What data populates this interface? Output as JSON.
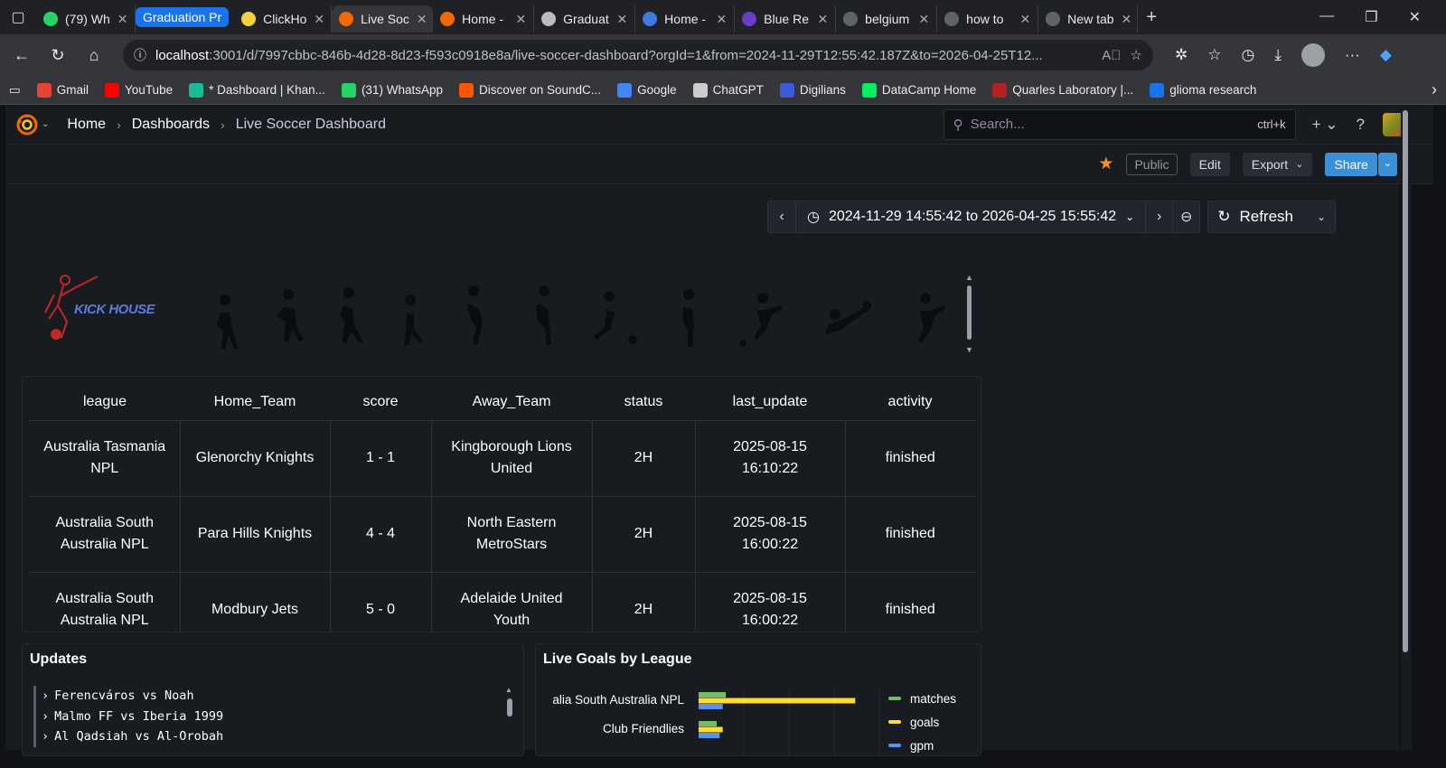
{
  "browser": {
    "tabs": [
      {
        "label": "(79) Wh",
        "icon": "whatsapp-icon",
        "color": "#25d366"
      },
      {
        "label": "Graduation Pr",
        "icon": "tab-group",
        "color": "#1a73e8"
      },
      {
        "label": "ClickHo",
        "icon": "clickhouse-icon",
        "color": "#f4d03f"
      },
      {
        "label": "Live Soc",
        "icon": "grafana-icon",
        "color": "#f46800"
      },
      {
        "label": "Home -",
        "icon": "grafana-icon",
        "color": "#f46800"
      },
      {
        "label": "Graduat",
        "icon": "chatgpt-icon",
        "color": "#bbbbbb"
      },
      {
        "label": "Home -",
        "icon": "copilot-icon",
        "color": "#3d7be0"
      },
      {
        "label": "Blue Re",
        "icon": "shield-icon",
        "color": "#6a3dc9"
      },
      {
        "label": "belgium",
        "icon": "search-icon",
        "color": "#5f6368"
      },
      {
        "label": "how to",
        "icon": "search-icon",
        "color": "#5f6368"
      },
      {
        "label": "New tab",
        "icon": "newtab-icon",
        "color": "#5f6368"
      }
    ],
    "url_host": "localhost",
    "url_rest": ":3001/d/7997cbbc-846b-4d28-8d23-f593c0918e8a/live-soccer-dashboard?orgId=1&from=2024-11-29T12:55:42.187Z&to=2026-04-25T12...",
    "bookmarks": [
      {
        "label": "Gmail",
        "color": "#ea4335"
      },
      {
        "label": "YouTube",
        "color": "#ff0000"
      },
      {
        "label": "* Dashboard | Khan...",
        "color": "#14bf96"
      },
      {
        "label": "(31) WhatsApp",
        "color": "#25d366"
      },
      {
        "label": "Discover on SoundC...",
        "color": "#ff5500"
      },
      {
        "label": "Google",
        "color": "#4285f4"
      },
      {
        "label": "ChatGPT",
        "color": "#cccccc"
      },
      {
        "label": "Digilians",
        "color": "#3b5bdb"
      },
      {
        "label": "DataCamp Home",
        "color": "#03ef62"
      },
      {
        "label": "Quarles Laboratory |...",
        "color": "#b22222"
      },
      {
        "label": "glioma research",
        "color": "#1a73e8"
      }
    ]
  },
  "grafana": {
    "breadcrumbs": [
      "Home",
      "Dashboards",
      "Live Soccer Dashboard"
    ],
    "search_placeholder": "Search...",
    "search_shortcut": "ctrl+k",
    "public_label": "Public",
    "edit_label": "Edit",
    "export_label": "Export",
    "share_label": "Share",
    "time_range": "2024-11-29 14:55:42 to 2026-04-25 15:55:42",
    "refresh_label": "Refresh",
    "banner_logo_text": "KICK HOUSE",
    "table": {
      "columns": [
        "league",
        "Home_Team",
        "score",
        "Away_Team",
        "status",
        "last_update",
        "activity"
      ],
      "rows": [
        [
          "Australia Tasmania NPL",
          "Glenorchy Knights",
          "1 - 1",
          "Kingborough Lions United",
          "2H",
          "2025-08-15 16:10:22",
          "finished"
        ],
        [
          "Australia South Australia NPL",
          "Para Hills Knights",
          "4 - 4",
          "North Eastern MetroStars",
          "2H",
          "2025-08-15 16:00:22",
          "finished"
        ],
        [
          "Australia South Australia NPL",
          "Modbury Jets",
          "5 - 0",
          "Adelaide United Youth",
          "2H",
          "2025-08-15 16:00:22",
          "finished"
        ]
      ]
    },
    "updates": {
      "title": "Updates",
      "items": [
        "Ferencváros vs Noah",
        "Malmo FF vs Iberia 1999",
        "Al Qadsiah vs Al-Orobah"
      ]
    }
  },
  "chart_data": {
    "type": "bar",
    "title": "Live Goals by League",
    "orientation": "horizontal",
    "categories": [
      "alia South Australia NPL",
      "Club Friendlies"
    ],
    "series": [
      {
        "name": "matches",
        "color": "#73bf69",
        "values": [
          9,
          6
        ]
      },
      {
        "name": "goals",
        "color": "#fade2a",
        "values": [
          52,
          8
        ]
      },
      {
        "name": "gpm",
        "color": "#5794f2",
        "values": [
          8,
          7
        ]
      }
    ],
    "xlim": [
      0,
      60
    ],
    "legend": "right"
  }
}
